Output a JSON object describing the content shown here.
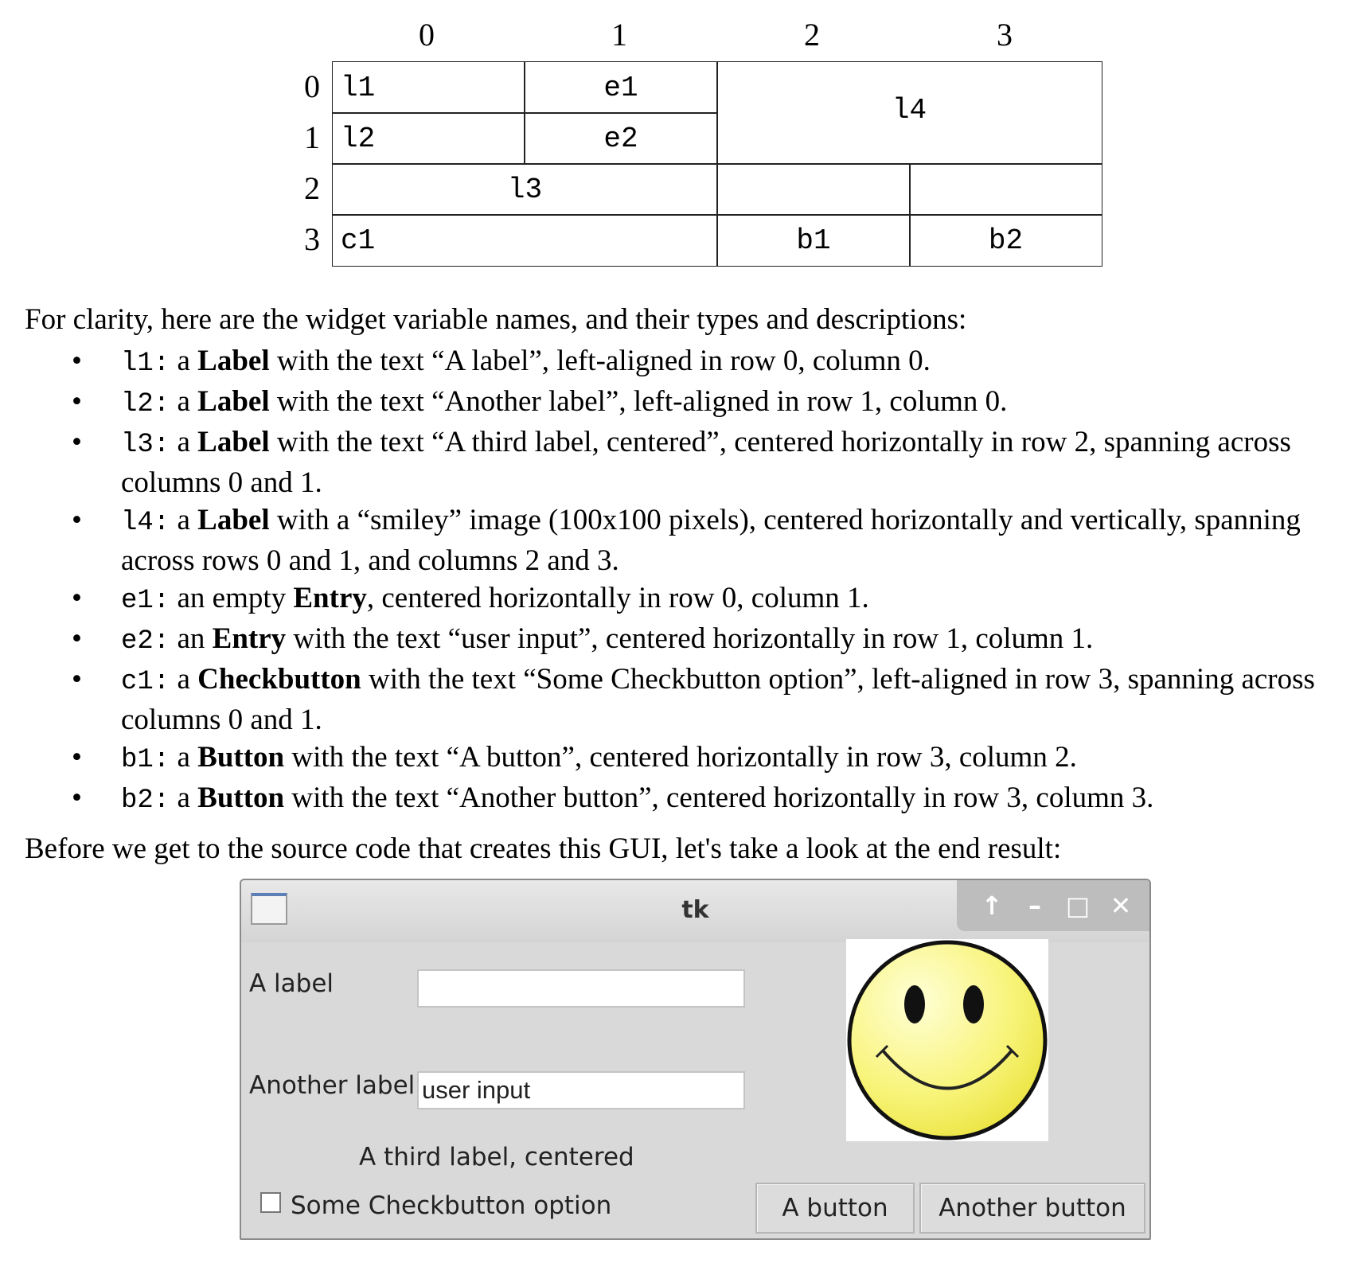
{
  "diagram": {
    "column_headers": [
      "0",
      "1",
      "2",
      "3"
    ],
    "row_headers": [
      "0",
      "1",
      "2",
      "3"
    ],
    "cells": {
      "l1": "l1",
      "e1": "e1",
      "l4": "l4",
      "l2": "l2",
      "e2": "e2",
      "l3": "l3",
      "c1": "c1",
      "b1": "b1",
      "b2": "b2"
    }
  },
  "intro": "For clarity, here are the widget variable names, and their types and descriptions:",
  "widgets": [
    {
      "name": "l1:",
      "pre": " a ",
      "type": "Label",
      "post": " with the text “A label”, left-aligned in row 0, column 0."
    },
    {
      "name": "l2:",
      "pre": " a ",
      "type": "Label",
      "post": " with the text “Another label”, left-aligned in row 1, column 0."
    },
    {
      "name": "l3:",
      "pre": " a ",
      "type": "Label",
      "post": " with the text “A third label, centered”, centered horizontally in row 2, spanning across columns 0 and 1."
    },
    {
      "name": "l4:",
      "pre": " a ",
      "type": "Label",
      "post": " with a “smiley” image (100x100 pixels), centered horizontally and vertically, spanning across rows 0 and 1, and columns 2 and 3."
    },
    {
      "name": "e1:",
      "pre": " an empty ",
      "type": "Entry",
      "post": ", centered horizontally in row 0, column 1."
    },
    {
      "name": "e2:",
      "pre": " an ",
      "type": "Entry",
      "post": " with the text “user input”, centered horizontally in row 1, column 1."
    },
    {
      "name": "c1:",
      "pre": " a ",
      "type": "Checkbutton",
      "post": " with the text “Some Checkbutton option”, left-aligned in row 3, spanning across columns 0 and 1."
    },
    {
      "name": "b1:",
      "pre": " a ",
      "type": "Button",
      "post": " with the text “A button”, centered horizontally in row 3, column 2."
    },
    {
      "name": "b2:",
      "pre": " a ",
      "type": "Button",
      "post": " with the text “Another button”, centered horizontally in row 3, column 3."
    }
  ],
  "outro": "Before we get to the source code that creates this GUI, let's take a look at the end result:",
  "tk_window": {
    "title": "tk",
    "controls": {
      "up": "↑",
      "minimize": "–",
      "maximize": "□",
      "close": "✕"
    },
    "label1": "A label",
    "entry1_value": "",
    "label2": "Another label",
    "entry2_value": "user input",
    "label3": "A third label, centered",
    "smiley_icon": "smiley-face-icon",
    "checkbutton_label": "Some Checkbutton option",
    "checkbutton_checked": false,
    "button1_label": "A button",
    "button2_label": "Another button"
  }
}
